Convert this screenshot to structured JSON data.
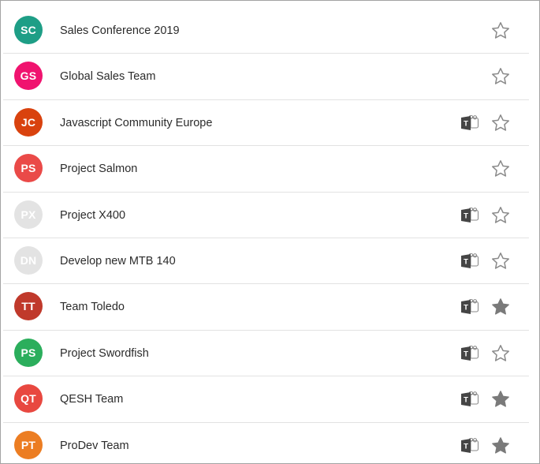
{
  "colors": {
    "star_outline": "#8a8a8a",
    "star_filled": "#7a7a7a",
    "teams_icon": "#444444",
    "divider": "#e2e2e2"
  },
  "teams": [
    {
      "initials": "SC",
      "name": "Sales Conference 2019",
      "avatar_color": "#1e9e86",
      "ms_teams": false,
      "favorite": false
    },
    {
      "initials": "GS",
      "name": "Global Sales Team",
      "avatar_color": "#f0136f",
      "ms_teams": false,
      "favorite": false
    },
    {
      "initials": "JC",
      "name": "Javascript Community Europe",
      "avatar_color": "#d9420e",
      "ms_teams": true,
      "favorite": false
    },
    {
      "initials": "PS",
      "name": "Project Salmon",
      "avatar_color": "#ea4a48",
      "ms_teams": false,
      "favorite": false
    },
    {
      "initials": "PX",
      "name": "Project X400",
      "avatar_color": "#e3e3e3",
      "ms_teams": true,
      "favorite": false
    },
    {
      "initials": "DN",
      "name": "Develop new MTB 140",
      "avatar_color": "#e3e3e3",
      "ms_teams": true,
      "favorite": false
    },
    {
      "initials": "TT",
      "name": "Team Toledo",
      "avatar_color": "#c0392b",
      "ms_teams": true,
      "favorite": true
    },
    {
      "initials": "PS",
      "name": "Project Swordfish",
      "avatar_color": "#2bae5c",
      "ms_teams": true,
      "favorite": false
    },
    {
      "initials": "QT",
      "name": "QESH Team",
      "avatar_color": "#e84840",
      "ms_teams": true,
      "favorite": true
    },
    {
      "initials": "PT",
      "name": "ProDev Team",
      "avatar_color": "#ec7d22",
      "ms_teams": true,
      "favorite": true
    }
  ]
}
